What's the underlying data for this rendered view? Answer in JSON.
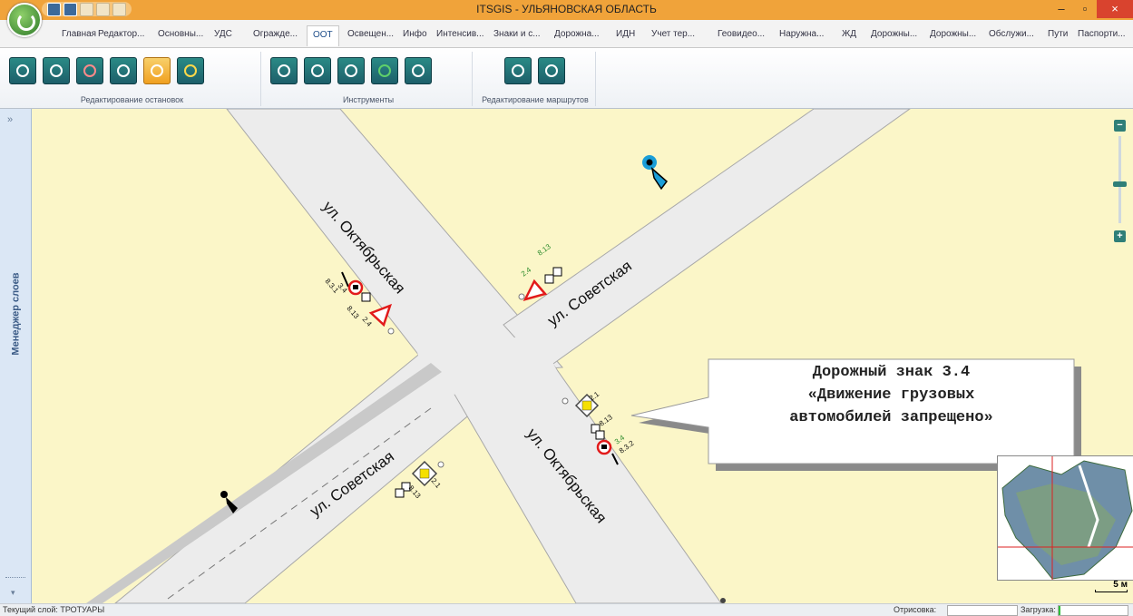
{
  "window": {
    "title": "ITSGIS - УЛЬЯНОВСКАЯ ОБЛАСТЬ",
    "minimize": "–",
    "maximize": "▫",
    "close": "×"
  },
  "tabs": [
    "Главная",
    "Редактор...",
    "Основны...",
    "УДС",
    "Огражде...",
    "ООТ",
    "Освещен...",
    "Инфо",
    "Интенсив...",
    "Знаки и с...",
    "Дорожна...",
    "ИДН",
    "Учет тер...",
    "Геовидео...",
    "Наружна...",
    "ЖД",
    "Дорожны...",
    "Дорожны...",
    "Обслужи...",
    "Пути",
    "Паспорти..."
  ],
  "active_tab": "ООТ",
  "ribbon": {
    "groups": [
      {
        "label": "Редактирование остановок",
        "buttons": [
          "add-stop",
          "add-stop-alt",
          "delete-stop",
          "edit-stop",
          "select-stop",
          "settings-stop"
        ]
      },
      {
        "label": "Инструменты",
        "buttons": [
          "search",
          "info",
          "zoom-find",
          "locate",
          "route-tool"
        ]
      },
      {
        "label": "Редактирование маршрутов",
        "buttons": [
          "add-route",
          "edit-route"
        ]
      }
    ]
  },
  "side_panel": {
    "label": "Менеджер слоев",
    "expand": "»",
    "collapse": "▾"
  },
  "map": {
    "streets": {
      "oktyabrskaya_top": "ул. Октябрьская",
      "sovetskaya_top": "ул. Советская",
      "sovetskaya_bottom": "ул. Советская",
      "oktyabrskaya_bottom": "ул. Октябрьская"
    },
    "sign_numbers": {
      "nw": [
        "8.3.1",
        "3.4",
        "8.13",
        "2.4"
      ],
      "ne": [
        "8.13",
        "2.4"
      ],
      "se": [
        "2.1",
        "8.13",
        "3.4",
        "8.3.2"
      ],
      "sw": [
        "2.1",
        "8.13"
      ]
    },
    "zoom": {
      "minus": "−",
      "plus": "+"
    },
    "callout": {
      "line1": "Дорожный знак 3.4",
      "line2": "«Движение грузовых",
      "line3": "автомобилей запрещено»"
    },
    "scale": "5 м"
  },
  "status": {
    "current_layer": "Текущий слой: ТРОТУАРЫ",
    "render_label": "Отрисовка:",
    "load_label": "Загрузка:",
    "load_progress": 0.03
  }
}
